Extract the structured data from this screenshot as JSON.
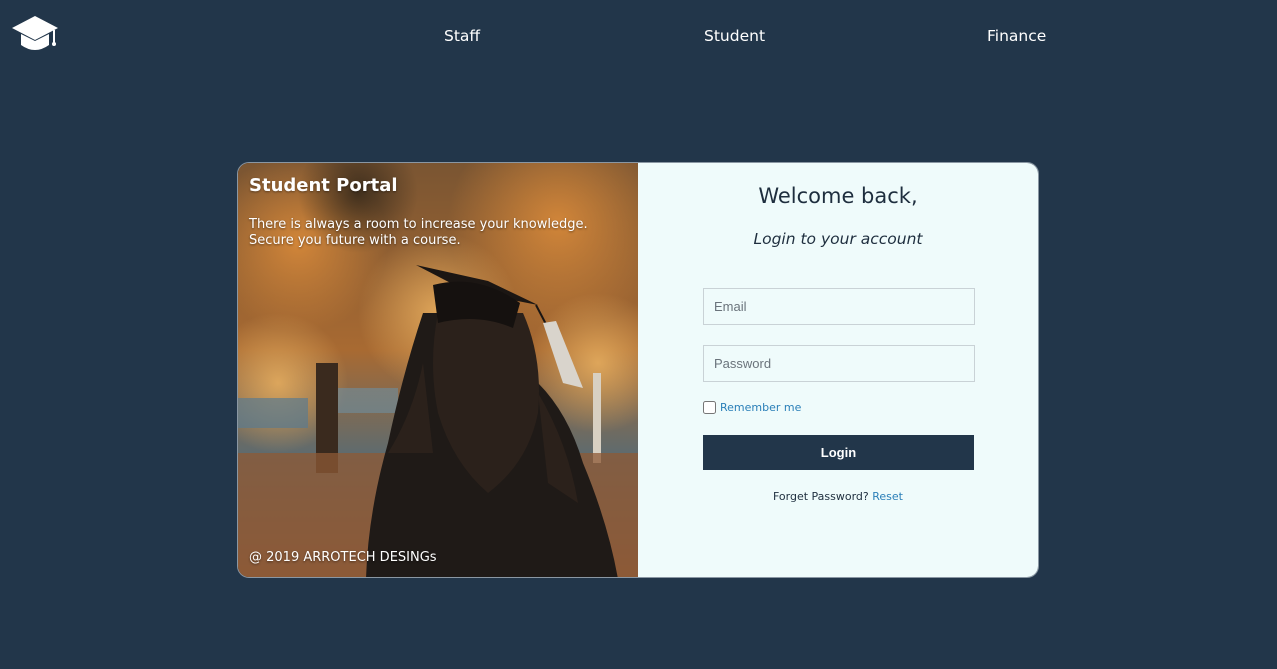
{
  "nav": {
    "logo_icon": "graduation-cap-icon",
    "links": [
      {
        "label": "Staff"
      },
      {
        "label": "Student"
      },
      {
        "label": "Finance"
      }
    ]
  },
  "portal": {
    "title": "Student Portal",
    "tagline_line1": "There is always a room to increase your knowledge.",
    "tagline_line2": "Secure you future with a course.",
    "copyright": "@ 2019 ARROTECH DESINGs"
  },
  "login": {
    "welcome": "Welcome back,",
    "subtitle": "Login to your account",
    "email_placeholder": "Email",
    "email_value": "",
    "password_placeholder": "Password",
    "password_value": "",
    "remember_label": "Remember me",
    "remember_checked": false,
    "button_label": "Login",
    "forgot_text": "Forget Password?",
    "reset_link": "Reset"
  },
  "colors": {
    "background": "#22364a",
    "form_panel": "#effbfb",
    "button": "#22364a",
    "link": "#2a7fb8"
  }
}
